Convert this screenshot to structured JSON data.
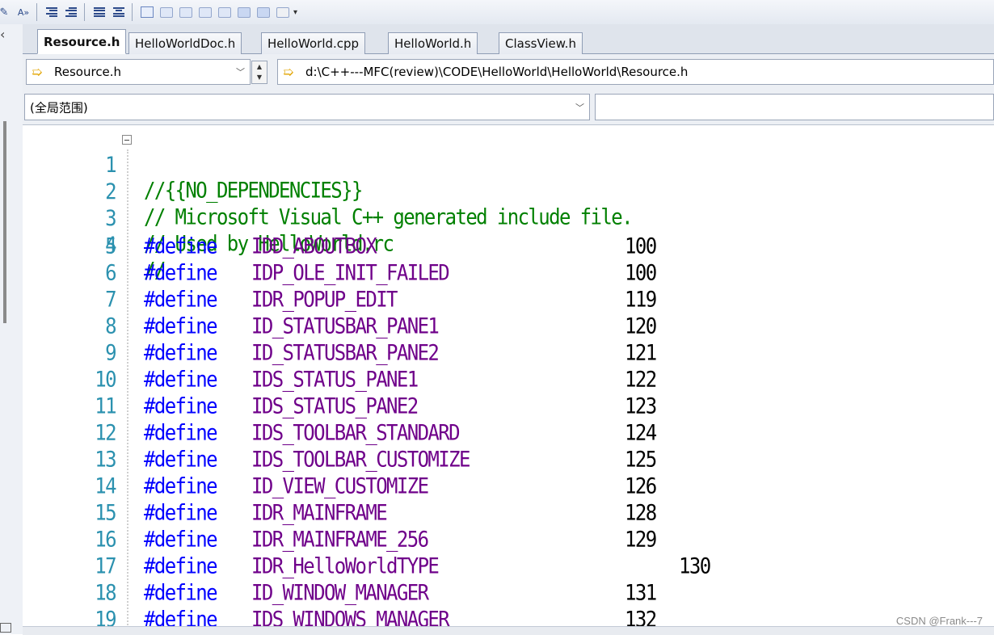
{
  "toolbar": {
    "buttons": [
      "format-icon",
      "font-size-icon",
      "outdent-icon",
      "indent-icon",
      "comment-icon",
      "uncomment-icon",
      "bookmark-toggle-icon",
      "bookmark-prev-icon",
      "bookmark-next-icon",
      "bookmark-prev-folder-icon",
      "bookmark-next-folder-icon",
      "bookmark-list-icon",
      "bookmark-clear-icon",
      "bookmark-disable-icon"
    ],
    "overflow": "▾"
  },
  "tabs": [
    {
      "label": "Resource.h",
      "active": true
    },
    {
      "label": "HelloWorldDoc.h",
      "active": false
    },
    {
      "label": "HelloWorld.cpp",
      "active": false
    },
    {
      "label": "HelloWorld.h",
      "active": false
    },
    {
      "label": "ClassView.h",
      "active": false
    }
  ],
  "pathbar": {
    "file_combo": "Resource.h",
    "path": "d:\\C++---MFC(review)\\CODE\\HelloWorld\\HelloWorld\\Resource.h"
  },
  "scopebar": {
    "scope_combo": "(全局范围)",
    "member_combo": ""
  },
  "code": {
    "comments": [
      "//{{NO_DEPENDENCIES}}",
      "// Microsoft Visual C++ generated include file.",
      "// Used by HelloWorld.rc",
      "//"
    ],
    "keyword": "#define",
    "defines": [
      {
        "line": "5",
        "name": "IDD_ABOUTBOX",
        "value": "100"
      },
      {
        "line": "6",
        "name": "IDP_OLE_INIT_FAILED",
        "value": "100"
      },
      {
        "line": "7",
        "name": "IDR_POPUP_EDIT",
        "value": "119"
      },
      {
        "line": "8",
        "name": "ID_STATUSBAR_PANE1",
        "value": "120"
      },
      {
        "line": "9",
        "name": "ID_STATUSBAR_PANE2",
        "value": "121"
      },
      {
        "line": "10",
        "name": "IDS_STATUS_PANE1",
        "value": "122"
      },
      {
        "line": "11",
        "name": "IDS_STATUS_PANE2",
        "value": "123"
      },
      {
        "line": "12",
        "name": "IDS_TOOLBAR_STANDARD",
        "value": "124"
      },
      {
        "line": "13",
        "name": "IDS_TOOLBAR_CUSTOMIZE",
        "value": "125"
      },
      {
        "line": "14",
        "name": "ID_VIEW_CUSTOMIZE",
        "value": "126"
      },
      {
        "line": "15",
        "name": "IDR_MAINFRAME",
        "value": "128"
      },
      {
        "line": "16",
        "name": "IDR_MAINFRAME_256",
        "value": "129"
      },
      {
        "line": "17",
        "name": "IDR_HelloWorldTYPE",
        "value": "130"
      },
      {
        "line": "18",
        "name": "ID_WINDOW_MANAGER",
        "value": "131"
      },
      {
        "line": "19",
        "name": "IDS_WINDOWS_MANAGER",
        "value": "132"
      }
    ],
    "comment_line_numbers": [
      "1",
      "2",
      "3",
      "4"
    ]
  },
  "colors": {
    "comment": "#008000",
    "keyword": "#0000ff",
    "macro": "#6f008a",
    "line_number": "#2b91af"
  },
  "watermark": "CSDN @Frank---7"
}
